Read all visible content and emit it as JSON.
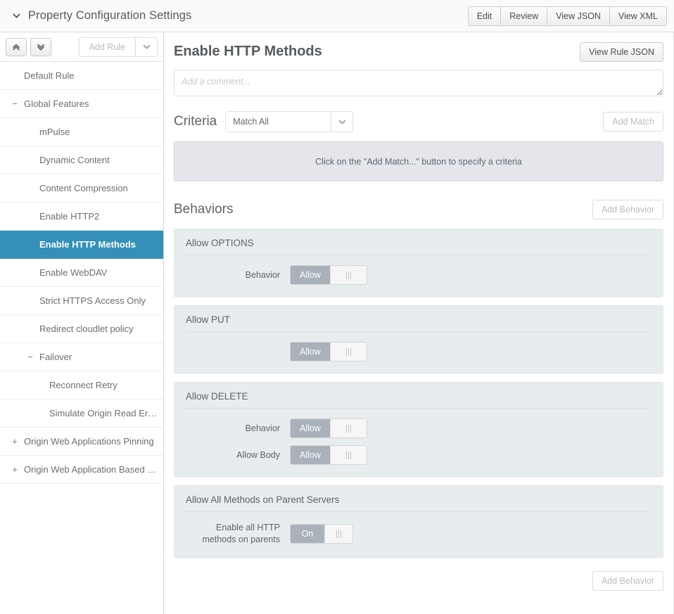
{
  "window": {
    "title": "Property Configuration Settings",
    "caret_icon": "chevron-down-icon",
    "toolbar_buttons": [
      {
        "label": "Edit",
        "name": "edit-button"
      },
      {
        "label": "Review",
        "name": "review-button"
      },
      {
        "label": "View JSON",
        "name": "view-json-button"
      },
      {
        "label": "View XML",
        "name": "view-xml-button"
      }
    ]
  },
  "sidebar": {
    "toolbar": {
      "collapse_all_icon": "double-chevron-up-icon",
      "expand_all_icon": "double-chevron-down-icon",
      "add_rule_label": "Add Rule",
      "add_rule_dropdown_icon": "chevron-down-icon"
    },
    "items": [
      {
        "label": "Default Rule",
        "level": 0,
        "twisty": "",
        "selected": false
      },
      {
        "label": "Global Features",
        "level": 1,
        "twisty": "−",
        "selected": false
      },
      {
        "label": "mPulse",
        "level": 2,
        "twisty": "",
        "selected": false
      },
      {
        "label": "Dynamic Content",
        "level": 2,
        "twisty": "",
        "selected": false
      },
      {
        "label": "Content Compression",
        "level": 2,
        "twisty": "",
        "selected": false
      },
      {
        "label": "Enable HTTP2",
        "level": 2,
        "twisty": "",
        "selected": false
      },
      {
        "label": "Enable HTTP Methods",
        "level": 2,
        "twisty": "",
        "selected": true
      },
      {
        "label": "Enable WebDAV",
        "level": 2,
        "twisty": "",
        "selected": false
      },
      {
        "label": "Strict HTTPS Access Only",
        "level": 2,
        "twisty": "",
        "selected": false
      },
      {
        "label": "Redirect cloudlet policy",
        "level": 2,
        "twisty": "",
        "selected": false
      },
      {
        "label": "Failover",
        "level": 2,
        "twisty": "−",
        "selected": false
      },
      {
        "label": "Reconnect Retry",
        "level": 3,
        "twisty": "",
        "selected": false
      },
      {
        "label": "Simulate Origin Read Error",
        "level": 3,
        "twisty": "",
        "selected": false
      },
      {
        "label": "Origin Web Applications Pinning",
        "level": 1,
        "twisty": "+",
        "selected": false
      },
      {
        "label": "Origin Web Application Based F…",
        "level": 1,
        "twisty": "+",
        "selected": false
      }
    ]
  },
  "main": {
    "rule_title": "Enable HTTP Methods",
    "view_rule_json_label": "View Rule JSON",
    "comment": {
      "value": "",
      "placeholder": "Add a comment..."
    },
    "criteria": {
      "section_label": "Criteria",
      "match_select_value": "Match All",
      "match_select_icon": "chevron-down-icon",
      "add_match_label": "Add Match",
      "empty_message": "Click on the \"Add Match...\" button to specify a criteria"
    },
    "behaviors": {
      "section_label": "Behaviors",
      "add_behavior_label": "Add Behavior",
      "add_behavior_bottom_label": "Add Behavior",
      "cards": [
        {
          "title": "Allow OPTIONS",
          "fields": [
            {
              "label": "Behavior",
              "toggle_value": "Allow",
              "toggle_state": "on",
              "show_label": true
            }
          ]
        },
        {
          "title": "Allow PUT",
          "fields": [
            {
              "label": "",
              "toggle_value": "Allow",
              "toggle_state": "on",
              "show_label": false
            }
          ]
        },
        {
          "title": "Allow DELETE",
          "fields": [
            {
              "label": "Behavior",
              "toggle_value": "Allow",
              "toggle_state": "on",
              "show_label": true
            },
            {
              "label": "Allow Body",
              "toggle_value": "Allow",
              "toggle_state": "on",
              "show_label": true
            }
          ]
        },
        {
          "title": "Allow All Methods on Parent Servers",
          "fields": [
            {
              "label": "Enable all HTTP methods on parents",
              "toggle_value": "On",
              "toggle_state": "on",
              "show_label": true,
              "narrow": true
            }
          ]
        }
      ]
    }
  },
  "colors": {
    "accent_selected": "#3490b8",
    "card_background": "#e7ecef",
    "criteria_empty_background": "#e4e6ec",
    "toggle_on": "#a9b2bb",
    "title_text": "#5a5a5a"
  }
}
